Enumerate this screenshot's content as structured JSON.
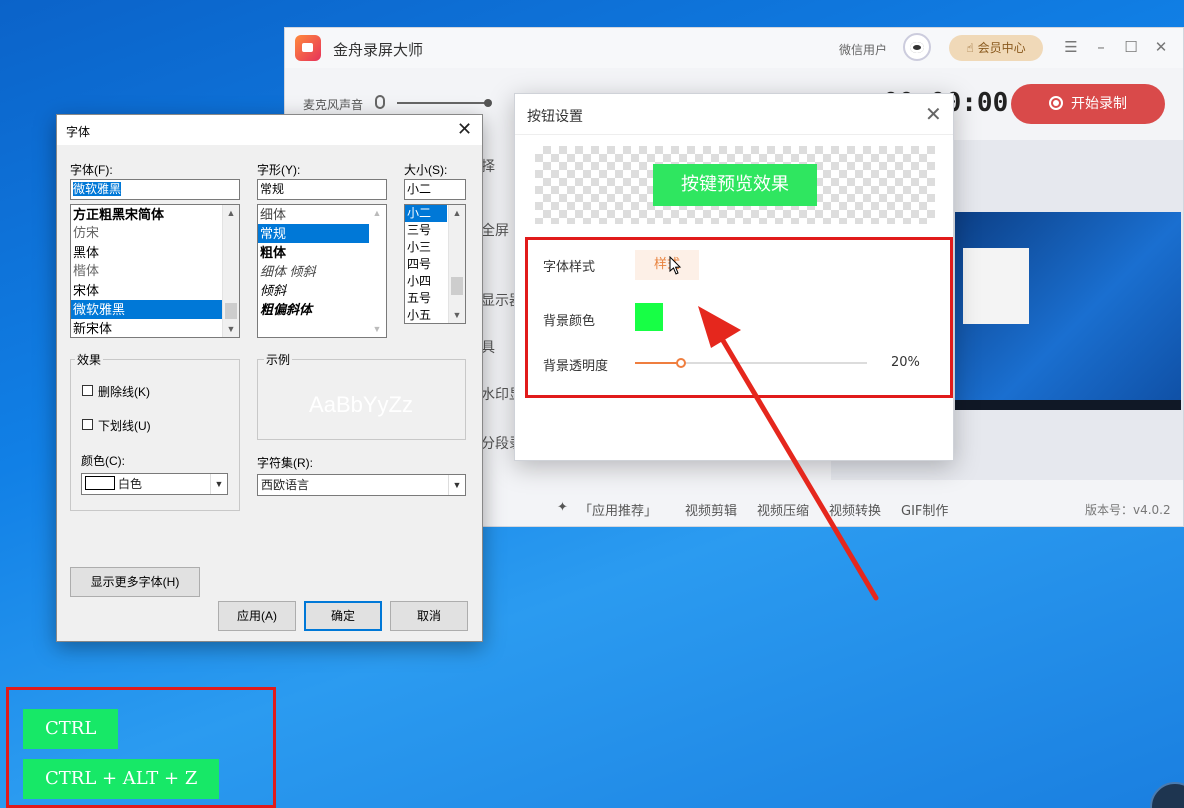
{
  "app": {
    "title": "金舟录屏大师",
    "user_name": "微信用户",
    "vip_label": "会员中心",
    "mic_label": "麦克风声音",
    "timer": "00:00:00",
    "record_label": "开始录制",
    "side_labels": [
      "择",
      "全屏",
      "显示器",
      "具",
      "水印显",
      "分段录"
    ],
    "footer_links": [
      "「应用推荐」",
      "视频剪辑",
      "视频压缩",
      "视频转换",
      "GIF制作"
    ],
    "version": "版本号：v4.0.2"
  },
  "button_dialog": {
    "title": "按钮设置",
    "preview_text": "按键预览效果",
    "font_style_label": "字体样式",
    "font_style_button": "样式",
    "bg_color_label": "背景颜色",
    "bg_color": "#17ff45",
    "opacity_label": "背景透明度",
    "opacity_value": "20%",
    "opacity_fraction": 0.2
  },
  "font_dialog": {
    "title": "字体",
    "font_label": "字体(F):",
    "font_value": "微软雅黑",
    "fonts": [
      "方正粗黑宋简体",
      "仿宋",
      "黑体",
      "楷体",
      "宋体",
      "微软雅黑",
      "新宋体"
    ],
    "selected_font_index": 5,
    "style_label": "字形(Y):",
    "style_value": "常规",
    "styles": [
      "细体",
      "常规",
      "粗体",
      "细体 倾斜",
      "倾斜",
      "粗偏斜体"
    ],
    "selected_style_index": 1,
    "size_label": "大小(S):",
    "size_value": "小二",
    "sizes": [
      "小二",
      "三号",
      "小三",
      "四号",
      "小四",
      "五号",
      "小五"
    ],
    "selected_size_index": 0,
    "effects_title": "效果",
    "strikeout_label": "删除线(K)",
    "underline_label": "下划线(U)",
    "color_label": "颜色(C):",
    "color_value": "白色",
    "sample_title": "示例",
    "sample_text": "AaBbYyZz",
    "charset_label": "字符集(R):",
    "charset_value": "西欧语言",
    "more_fonts_button": "显示更多字体(H)",
    "apply_button": "应用(A)",
    "ok_button": "确定",
    "cancel_button": "取消"
  },
  "key_overlays": [
    "CTRL",
    "CTRL + ALT + Z"
  ],
  "colors": {
    "accent_orange": "#ef7e3f",
    "record_red": "#d94a4a",
    "highlight_red": "#e11b1b",
    "key_green": "#17e867"
  }
}
